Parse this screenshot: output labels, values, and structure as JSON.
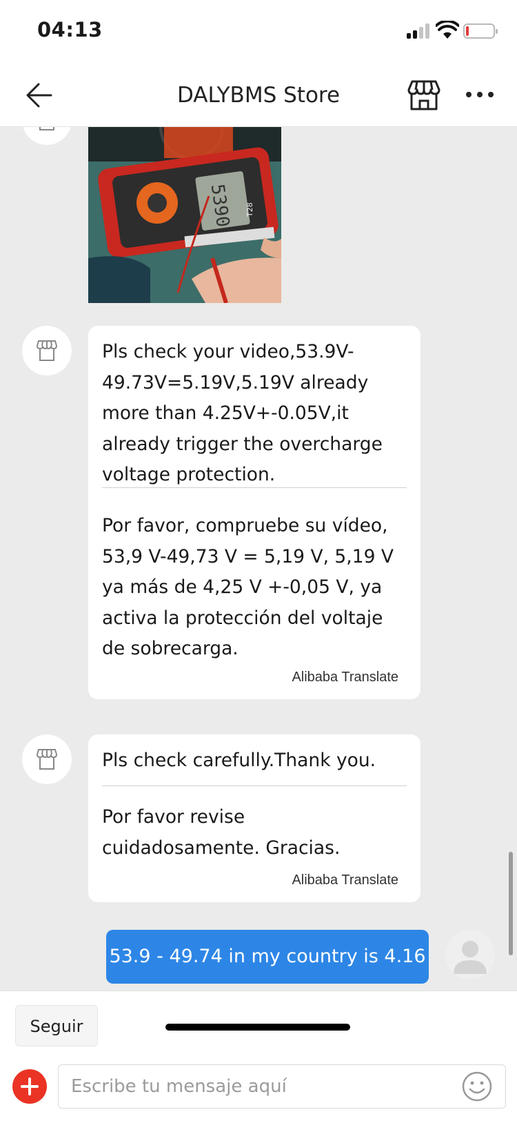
{
  "status_bar": {
    "time": "04:13"
  },
  "header": {
    "title": "DALYBMS Store"
  },
  "messages": [
    {
      "original": "Pls check your video,53.9V-49.73V=5.19V,5.19V already more than 4.25V+-0.05V,it already trigger the overcharge voltage protection.",
      "translation": "Por favor, compruebe su vídeo, 53,9 V-49,73 V = 5,19 V, 5,19 V ya más de 4,25 V +-0,05 V, ya activa la protección del voltaje de sobrecarga.",
      "translate_label": "Alibaba Translate"
    },
    {
      "original": "Pls check carefully.Thank you.",
      "translation": "Por favor revise cuidadosamente. Gracias.",
      "translate_label": "Alibaba Translate"
    }
  ],
  "user_message": {
    "text": "53.9 - 49.74 in my country is 4.16"
  },
  "video_thumb": {
    "meter_reading": "5390",
    "model": "T28"
  },
  "footer": {
    "follow_label": "Seguir",
    "input_placeholder": "Escribe tu mensaje aquí"
  },
  "colors": {
    "accent_blue": "#2d86e6",
    "plus_red": "#ea3325",
    "chat_bg": "#ebebeb"
  },
  "icons": [
    "back-arrow-icon",
    "store-icon",
    "more-icon",
    "plus-icon",
    "emoji-icon",
    "signal-icon",
    "wifi-icon",
    "battery-icon"
  ]
}
